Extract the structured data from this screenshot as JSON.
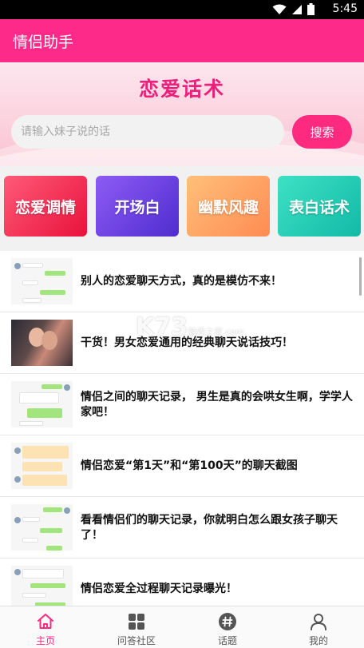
{
  "status": {
    "time": "5:45"
  },
  "app": {
    "title": "情侣助手"
  },
  "hero": {
    "heading": "恋爱话术",
    "search_placeholder": "请输入妹子说的话",
    "search_button": "搜索"
  },
  "categories": [
    {
      "label": "恋爱调情"
    },
    {
      "label": "开场白"
    },
    {
      "label": "幽默风趣"
    },
    {
      "label": "表白话术"
    }
  ],
  "articles": [
    {
      "title": "别人的恋爱聊天方式，真的是模仿不来！"
    },
    {
      "title": "干货！男女恋爱通用的经典聊天说话技巧！"
    },
    {
      "title": "情侣之间的聊天记录， 男生是真的会哄女生啊，学学人家吧！"
    },
    {
      "title": "情侣恋爱“第1天”和“第100天”的聊天截图"
    },
    {
      "title": "看看情侣们的聊天记录，你就明白怎么跟女孩子聊天了！"
    },
    {
      "title": "情侣恋爱全过程聊天记录曝光！"
    }
  ],
  "watermark": {
    "logo": "K73",
    "sub": "游戏之家",
    "domain": ".com"
  },
  "tabs": [
    {
      "label": "主页",
      "icon": "home-icon",
      "active": true
    },
    {
      "label": "问答社区",
      "icon": "grid-icon",
      "active": false
    },
    {
      "label": "话题",
      "icon": "hashtag-icon",
      "active": false
    },
    {
      "label": "我的",
      "icon": "person-icon",
      "active": false
    }
  ],
  "colors": {
    "primary": "#fe2a8a",
    "accent": "#fe2a80",
    "heading": "#ee1f7a"
  }
}
